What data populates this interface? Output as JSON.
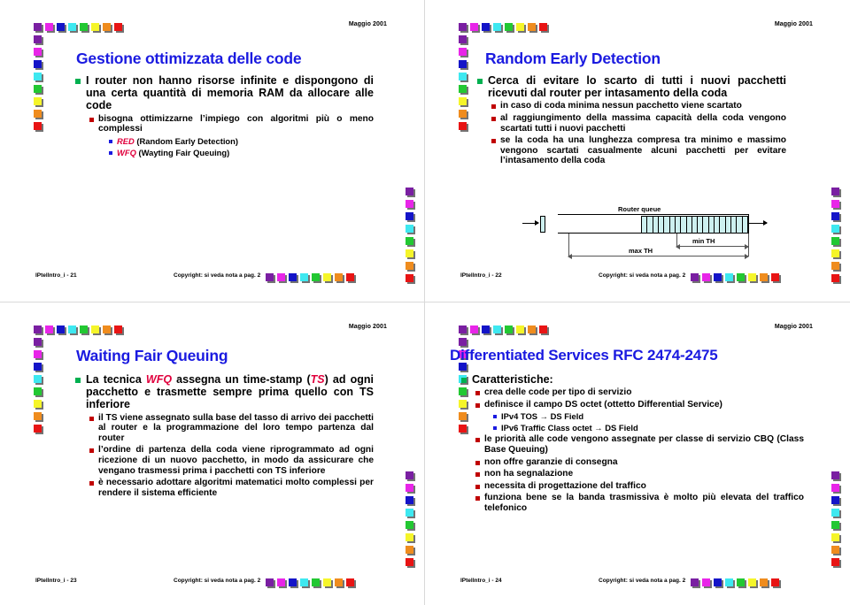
{
  "palette": {
    "cube_colors": [
      "#7a1fa2",
      "#e825e8",
      "#1414c8",
      "#3ee8f0",
      "#22c832",
      "#f5f52a",
      "#ef8c1e",
      "#e81414"
    ],
    "title_blue": "#1a1ae0",
    "bullet_green": "#00b050",
    "bullet_red": "#c00000",
    "bullet_blue": "#1a1ae0",
    "emphasis_red": "#e0003c",
    "queue_cell_fill": "#cdf0ef"
  },
  "common": {
    "date": "Maggio 2001",
    "copyright": "Copyright: si veda nota a pag. 2"
  },
  "slides": [
    {
      "id": "slide-1",
      "title": "Gestione ottimizzata delle code",
      "footer_id": "IPtelIntro_i - 21",
      "bullets": {
        "l1": "I router non hanno risorse infinite e dispongono di una certa quantità di memoria RAM da allocare alle code",
        "l2": "bisogna ottimizzarne l’impiego con algoritmi più o meno complessi",
        "l3a_em": "RED",
        "l3a_rest": " (Random Early Detection)",
        "l3b_em": "WFQ",
        "l3b_rest": " (Wayting Fair Queuing)"
      }
    },
    {
      "id": "slide-2",
      "title": "Random Early Detection",
      "footer_id": "IPtelIntro_i - 22",
      "bullets": {
        "l1": "Cerca di evitare lo scarto di tutti i nuovi pacchetti ricevuti dal router per intasamento della coda",
        "l2a": "in caso di coda minima nessun pacchetto viene scartato",
        "l2b": "al raggiungimento della massima capacità della coda vengono scartati tutti i nuovi pacchetti",
        "l2c": "se la coda ha una lunghezza compresa tra minimo e massimo vengono scartati casualmente alcuni pacchetti per evitare l’intasamento della coda"
      },
      "figure": {
        "title": "Router queue",
        "label_min": "min TH",
        "label_max": "max TH",
        "cell_count": 19
      }
    },
    {
      "id": "slide-3",
      "title": "Waiting Fair Queuing",
      "footer_id": "IPtelIntro_i - 23",
      "bullets": {
        "l1_a": "La tecnica ",
        "l1_em1": "WFQ",
        "l1_b": " assegna un time-stamp (",
        "l1_em2": "TS",
        "l1_c": ") ad ogni pacchetto e trasmette sempre prima quello con TS inferiore",
        "l2a": "il TS viene assegnato sulla base del tasso di arrivo dei pacchetti al router e la programmazione del loro tempo  partenza dal router",
        "l2b": "l’ordine di partenza della coda viene riprogrammato ad ogni ricezione di un nuovo pacchetto, in modo da assicurare che vengano trasmessi prima i pacchetti con TS inferiore",
        "l2c": "è necessario adottare algoritmi matematici molto complessi per rendere il sistema efficiente"
      }
    },
    {
      "id": "slide-4",
      "title": "Differentiated Services RFC 2474-2475",
      "footer_id": "IPtelIntro_i - 24",
      "bullets": {
        "l1": "Caratteristiche:",
        "l2a": "crea delle code per tipo di servizio",
        "l2b": "definisce il campo DS octet (ottetto Differential Service)",
        "l3a": "IPv4 TOS → DS Field",
        "l3b": "IPv6 Traffic Class octet → DS Field",
        "l2c": "le priorità alle code vengono assegnate per classe di servizio CBQ (Class Base Queuing)",
        "l2d": "non offre garanzie di consegna",
        "l2e": "non ha segnalazione",
        "l2f": "necessita di progettazione del traffico",
        "l2g": "funziona bene se la banda trasmissiva è molto più elevata del traffico telefonico"
      }
    }
  ]
}
